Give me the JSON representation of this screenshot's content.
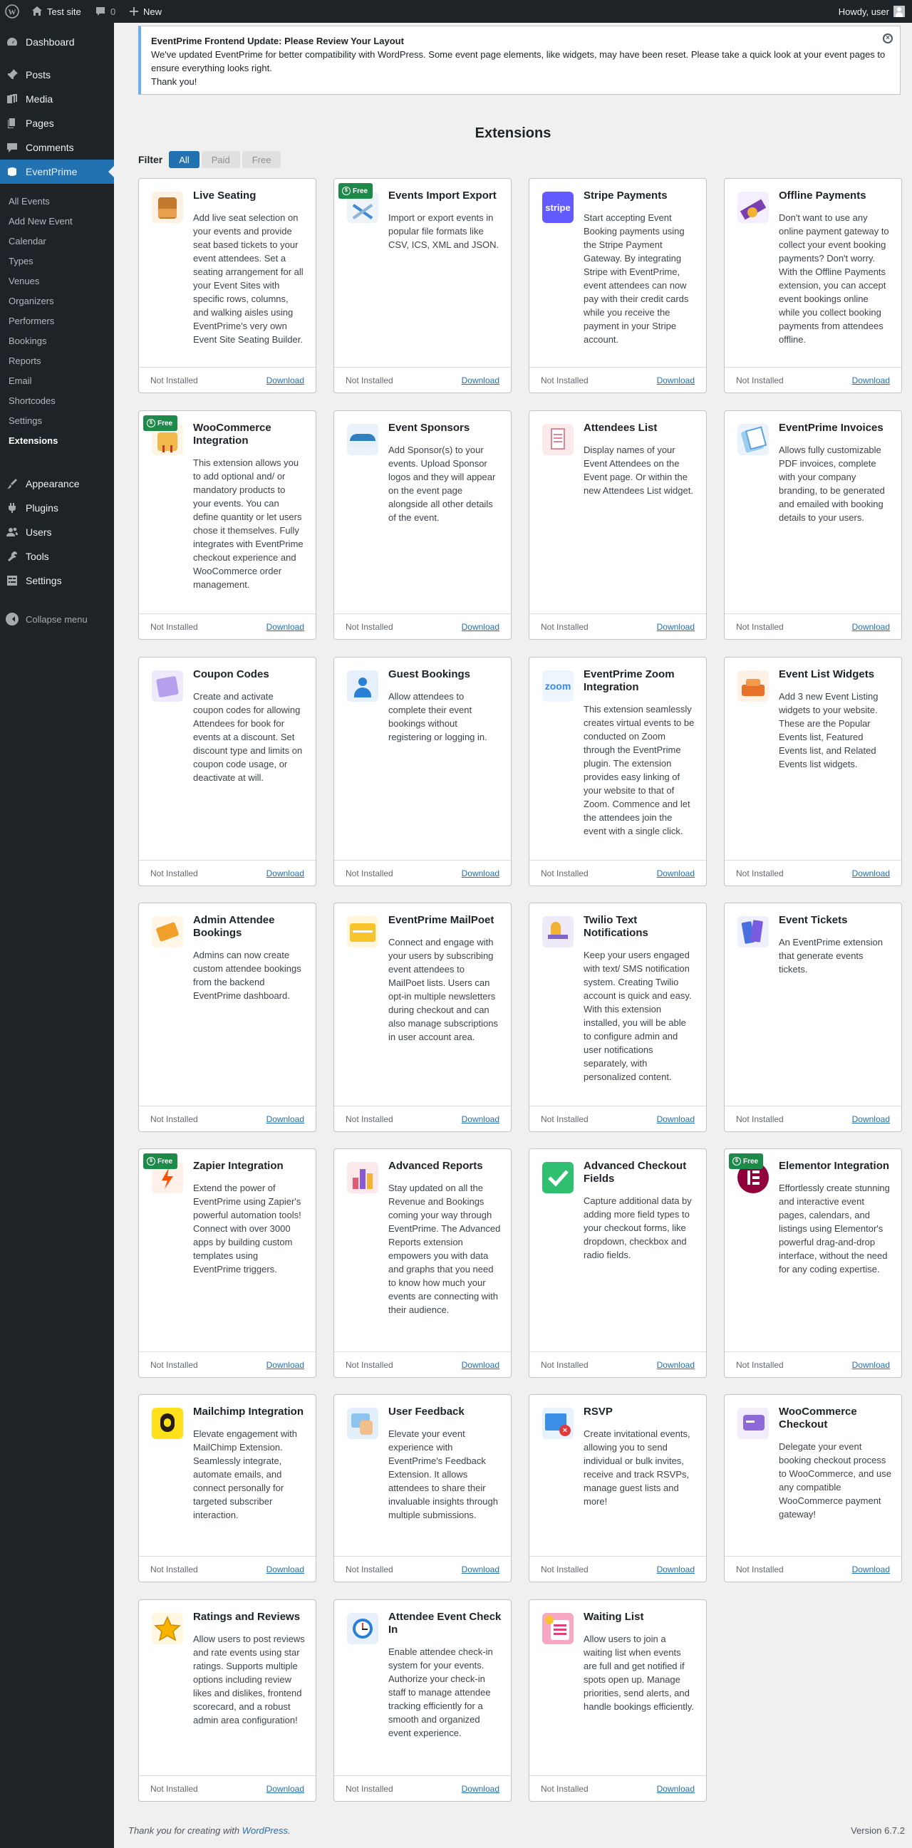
{
  "adminbar": {
    "site_name": "Test site",
    "comments_count": "0",
    "new_label": "New",
    "howdy": "Howdy, user"
  },
  "menu": {
    "dashboard": "Dashboard",
    "posts": "Posts",
    "media": "Media",
    "pages": "Pages",
    "comments": "Comments",
    "eventprime": "EventPrime",
    "appearance": "Appearance",
    "plugins": "Plugins",
    "users": "Users",
    "tools": "Tools",
    "settings": "Settings",
    "collapse": "Collapse menu",
    "submenu": [
      "All Events",
      "Add New Event",
      "Calendar",
      "Types",
      "Venues",
      "Organizers",
      "Performers",
      "Bookings",
      "Reports",
      "Email",
      "Shortcodes",
      "Settings",
      "Extensions"
    ]
  },
  "notice": {
    "title": "EventPrime Frontend Update: Please Review Your Layout",
    "body": "We've updated EventPrime for better compatibility with WordPress. Some event page elements, like widgets, may have been reset. Please take a quick look at your event pages to ensure everything looks right.",
    "thanks": "Thank you!"
  },
  "page_title": "Extensions",
  "filter": {
    "label": "Filter",
    "all": "All",
    "paid": "Paid",
    "free": "Free"
  },
  "status_label": "Not Installed",
  "download_label": "Download",
  "free_badge": "Free",
  "extensions": [
    {
      "title": "Live Seating",
      "desc": "Add live seat selection on your events and provide seat based tickets to your event attendees. Set a seating arrangement for all your Event Sites with specific rows, columns, and walking aisles using EventPrime's very own Event Site Seating Builder.",
      "icon": "seating-icon",
      "free": false
    },
    {
      "title": "Events Import Export",
      "desc": "Import or export events in popular file formats like CSV, ICS, XML and JSON.",
      "icon": "import-export-icon",
      "free": true
    },
    {
      "title": "Stripe Payments",
      "desc": "Start accepting Event Booking payments using the Stripe Payment Gateway. By integrating Stripe with EventPrime, event attendees can now pay with their credit cards while you receive the payment in your Stripe account.",
      "icon": "stripe-icon",
      "icon_text": "stripe",
      "free": false
    },
    {
      "title": "Offline Payments",
      "desc": "Don't want to use any online payment gateway to collect your event booking payments? Don't worry. With the Offline Payments extension, you can accept event bookings online while you collect booking payments from attendees offline.",
      "icon": "offline-payment-icon",
      "free": false
    },
    {
      "title": "WooCommerce Integration",
      "desc": "This extension allows you to add optional and/ or mandatory products to your events. You can define quantity or let users chose it themselves. Fully integrates with EventPrime checkout experience and WooCommerce order management.",
      "icon": "woocommerce-bag-icon",
      "free": true
    },
    {
      "title": "Event Sponsors",
      "desc": "Add Sponsor(s) to your events. Upload Sponsor logos and they will appear on the event page alongside all other details of the event.",
      "icon": "sponsor-icon",
      "free": false
    },
    {
      "title": "Attendees List",
      "desc": "Display names of your Event Attendees on the Event page. Or within the new Attendees List widget.",
      "icon": "attendees-list-icon",
      "free": false
    },
    {
      "title": "EventPrime Invoices",
      "desc": "Allows fully customizable PDF invoices, complete with your company branding, to be generated and emailed with booking details to your users.",
      "icon": "invoice-icon",
      "free": false
    },
    {
      "title": "Coupon Codes",
      "desc": "Create and activate coupon codes for allowing Attendees for book for events at a discount. Set discount type and limits on coupon code usage, or deactivate at will.",
      "icon": "coupon-icon",
      "free": false
    },
    {
      "title": "Guest Bookings",
      "desc": "Allow attendees to complete their event bookings without registering or logging in.",
      "icon": "guest-icon",
      "free": false
    },
    {
      "title": "EventPrime Zoom Integration",
      "desc": "This extension seamlessly creates virtual events to be conducted on Zoom through the EventPrime plugin. The extension provides easy linking of your website to that of Zoom. Commence and let the attendees join the event with a single click.",
      "icon": "zoom-icon",
      "icon_text": "zoom",
      "free": false
    },
    {
      "title": "Event List Widgets",
      "desc": "Add 3 new Event Listing widgets to your website. These are the Popular Events list, Featured Events list, and Related Events list widgets.",
      "icon": "widgets-icon",
      "free": false
    },
    {
      "title": "Admin Attendee Bookings",
      "desc": "Admins can now create custom attendee bookings from the backend EventPrime dashboard.",
      "icon": "admin-booking-icon",
      "free": false
    },
    {
      "title": "EventPrime MailPoet",
      "desc": "Connect and engage with your users by subscribing event attendees to MailPoet lists. Users can opt-in multiple newsletters during checkout and can also manage subscriptions in user account area.",
      "icon": "mailpoet-icon",
      "free": false
    },
    {
      "title": "Twilio Text Notifications",
      "desc": "Keep your users engaged with text/ SMS notification system. Creating Twilio account is quick and easy. With this extension installed, you will be able to configure admin and user notifications separately, with personalized content.",
      "icon": "twilio-icon",
      "free": false
    },
    {
      "title": "Event Tickets",
      "desc": "An EventPrime extension that generate events tickets.",
      "icon": "tickets-icon",
      "free": false
    },
    {
      "title": "Zapier Integration",
      "desc": "Extend the power of EventPrime using Zapier's powerful automation tools! Connect with over 3000 apps by building custom templates using EventPrime triggers.",
      "icon": "zapier-icon",
      "free": true
    },
    {
      "title": "Advanced Reports",
      "desc": "Stay updated on all the Revenue and Bookings coming your way through EventPrime. The Advanced Reports extension empowers you with data and graphs that you need to know how much your events are connecting with their audience.",
      "icon": "reports-icon",
      "free": false
    },
    {
      "title": "Advanced Checkout Fields",
      "desc": "Capture additional data by adding more field types to your checkout forms, like dropdown, checkbox and radio fields.",
      "icon": "checkout-fields-icon",
      "free": false
    },
    {
      "title": "Elementor Integration",
      "desc": "Effortlessly create stunning and interactive event pages, calendars, and listings using Elementor's powerful drag-and-drop interface, without the need for any coding expertise.",
      "icon": "elementor-icon",
      "free": true
    },
    {
      "title": "Mailchimp Integration",
      "desc": "Elevate engagement with MailChimp Extension. Seamlessly integrate, automate emails, and connect personally for targeted subscriber interaction.",
      "icon": "mailchimp-icon",
      "free": false
    },
    {
      "title": "User Feedback",
      "desc": "Elevate your event experience with EventPrime's Feedback Extension. It allows attendees to share their invaluable insights through multiple submissions.",
      "icon": "feedback-icon",
      "free": false
    },
    {
      "title": "RSVP",
      "desc": "Create invitational events, allowing you to send individual or bulk invites, receive and track RSVPs, manage guest lists and more!",
      "icon": "rsvp-icon",
      "free": false
    },
    {
      "title": "WooCommerce Checkout",
      "desc": "Delegate your event booking checkout process to WooCommerce, and use any compatible WooCommerce payment gateway!",
      "icon": "woo-checkout-icon",
      "free": false
    },
    {
      "title": "Ratings and Reviews",
      "desc": "Allow users to post reviews and rate events using star ratings. Supports multiple options including review likes and dislikes, frontend scorecard, and a robust admin area configuration!",
      "icon": "star-icon",
      "free": false
    },
    {
      "title": "Attendee Event Check In",
      "desc": "Enable attendee check-in system for your events. Authorize your check-in staff to manage attendee tracking efficiently for a smooth and organized event experience.",
      "icon": "checkin-clock-icon",
      "free": false
    },
    {
      "title": "Waiting List",
      "desc": "Allow users to join a waiting list when events are full and get notified if spots open up. Manage priorities, send alerts, and handle bookings efficiently.",
      "icon": "waiting-list-icon",
      "free": false
    }
  ],
  "footer": {
    "thanks_prefix": "Thank you for creating with ",
    "thanks_link": "WordPress",
    "version": "Version 6.7.2"
  }
}
